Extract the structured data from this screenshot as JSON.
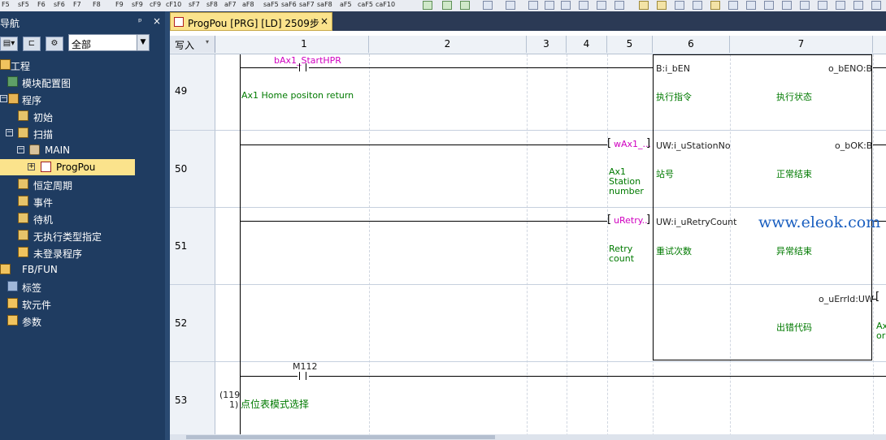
{
  "toolbar": {
    "function_keys": [
      "F5",
      "sF5",
      "F6",
      "sF6",
      "F7",
      "F8",
      "F9",
      "sF9",
      "cF9",
      "cF10",
      "sF7",
      "sF8",
      "aF7",
      "aF8",
      "saF5",
      "saF6",
      "saF7",
      "saF8",
      "aF5",
      "caF5",
      "caF10"
    ]
  },
  "navigator": {
    "title": "导航",
    "pin": "ᵖ",
    "close": "×",
    "filter_value": "全部",
    "items": [
      {
        "label": "工程",
        "icon": "project-icon"
      },
      {
        "label": "模块配置图",
        "icon": "module-config-icon"
      },
      {
        "label": "程序",
        "icon": "program-icon"
      },
      {
        "label": "初始",
        "icon": "program-folder-icon"
      },
      {
        "label": "扫描",
        "icon": "program-folder-icon"
      },
      {
        "label": "MAIN",
        "icon": "task-icon"
      },
      {
        "label": "ProgPou",
        "icon": "ladder-program-icon"
      },
      {
        "label": "恒定周期",
        "icon": "program-folder-icon"
      },
      {
        "label": "事件",
        "icon": "program-folder-icon"
      },
      {
        "label": "待机",
        "icon": "program-folder-icon"
      },
      {
        "label": "无执行类型指定",
        "icon": "program-folder-icon"
      },
      {
        "label": "未登录程序",
        "icon": "unregistered-program-icon"
      },
      {
        "label": "FB/FUN",
        "icon": "fb-fun-icon"
      },
      {
        "label": "标签",
        "icon": "label-icon"
      },
      {
        "label": "软元件",
        "icon": "device-icon"
      },
      {
        "label": "参数",
        "icon": "parameter-icon"
      }
    ]
  },
  "editor": {
    "tab_title": "ProgPou [PRG] [LD] 2509步",
    "tab_close": "×",
    "mode_label": "写入",
    "columns": [
      "1",
      "2",
      "3",
      "4",
      "5",
      "6",
      "7"
    ],
    "rows": [
      "49",
      "50",
      "51",
      "52",
      "53"
    ],
    "rung49": {
      "contact": "bAx1_StartHPR",
      "comment": "Ax1 Home positon return"
    },
    "rung50": {
      "input": "wAx1_...",
      "comment": [
        "Ax1",
        "Station",
        "number"
      ]
    },
    "rung51": {
      "input": "uRetry...",
      "comment": [
        "Retry",
        "count"
      ]
    },
    "rung52": {
      "output_comment": [
        "Ax",
        "or"
      ]
    },
    "rung53": {
      "contact": "M112",
      "step_a": "(119",
      "step_b": "1)",
      "comment": "点位表模式选择"
    },
    "fb": {
      "in1": "B:i_bEN",
      "in1_comment": "执行指令",
      "out1": "o_bENO:B",
      "out1_comment": "执行状态",
      "in2": "UW:i_uStationNo",
      "in2_comment": "站号",
      "out2": "o_bOK:B",
      "out2_comment": "正常结束",
      "in3": "UW:i_uRetryCount",
      "in3_comment": "重试次数",
      "out3_comment": "异常结束",
      "out4": "o_uErrId:UW",
      "out4_comment": "出错代码"
    },
    "watermark": "www.eleok.com"
  }
}
